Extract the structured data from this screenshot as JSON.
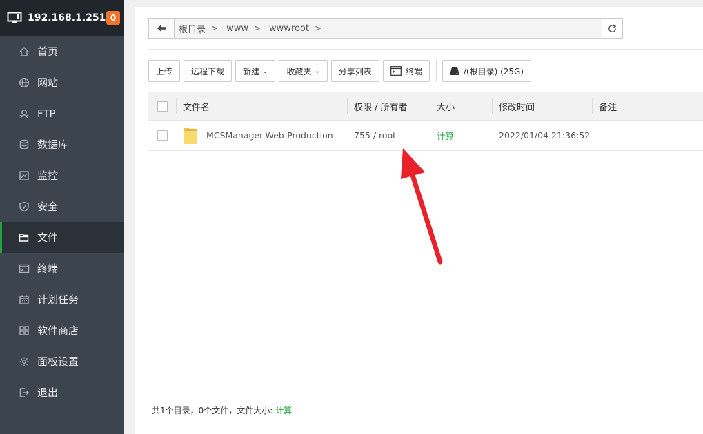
{
  "sidebar": {
    "host": "192.168.1.251",
    "badge": "0",
    "items": [
      {
        "label": "首页",
        "icon": "home-icon"
      },
      {
        "label": "网站",
        "icon": "globe-icon"
      },
      {
        "label": "FTP",
        "icon": "ftp-icon"
      },
      {
        "label": "数据库",
        "icon": "database-icon"
      },
      {
        "label": "监控",
        "icon": "monitor-icon"
      },
      {
        "label": "安全",
        "icon": "shield-icon"
      },
      {
        "label": "文件",
        "icon": "folder-icon",
        "active": true
      },
      {
        "label": "终端",
        "icon": "terminal-icon"
      },
      {
        "label": "计划任务",
        "icon": "calendar-icon"
      },
      {
        "label": "软件商店",
        "icon": "apps-icon"
      },
      {
        "label": "面板设置",
        "icon": "gear-icon"
      },
      {
        "label": "退出",
        "icon": "logout-icon"
      }
    ]
  },
  "path": {
    "crumbs": [
      "根目录",
      "www",
      "wwwroot"
    ]
  },
  "toolbar": {
    "upload": "上传",
    "remote_download": "远程下载",
    "new": "新建",
    "favorites": "收藏夹",
    "share_list": "分享列表",
    "terminal": "终端",
    "disk": "/(根目录) (25G)"
  },
  "table": {
    "headers": {
      "name": "文件名",
      "perm": "权限 / 所有者",
      "size": "大小",
      "mtime": "修改时间",
      "note": "备注"
    },
    "rows": [
      {
        "name": "MCSManager-Web-Production",
        "perm": "755 / root",
        "size": "计算",
        "mtime": "2022/01/04 21:36:52",
        "note": ""
      }
    ]
  },
  "footer": {
    "summary": "共1个目录，0个文件，文件大小:",
    "size_link": "计算"
  },
  "colors": {
    "accent": "#20a53a",
    "sidebar_bg": "#3c444d",
    "badge": "#f0742a",
    "annotation_arrow": "#e8212a"
  }
}
